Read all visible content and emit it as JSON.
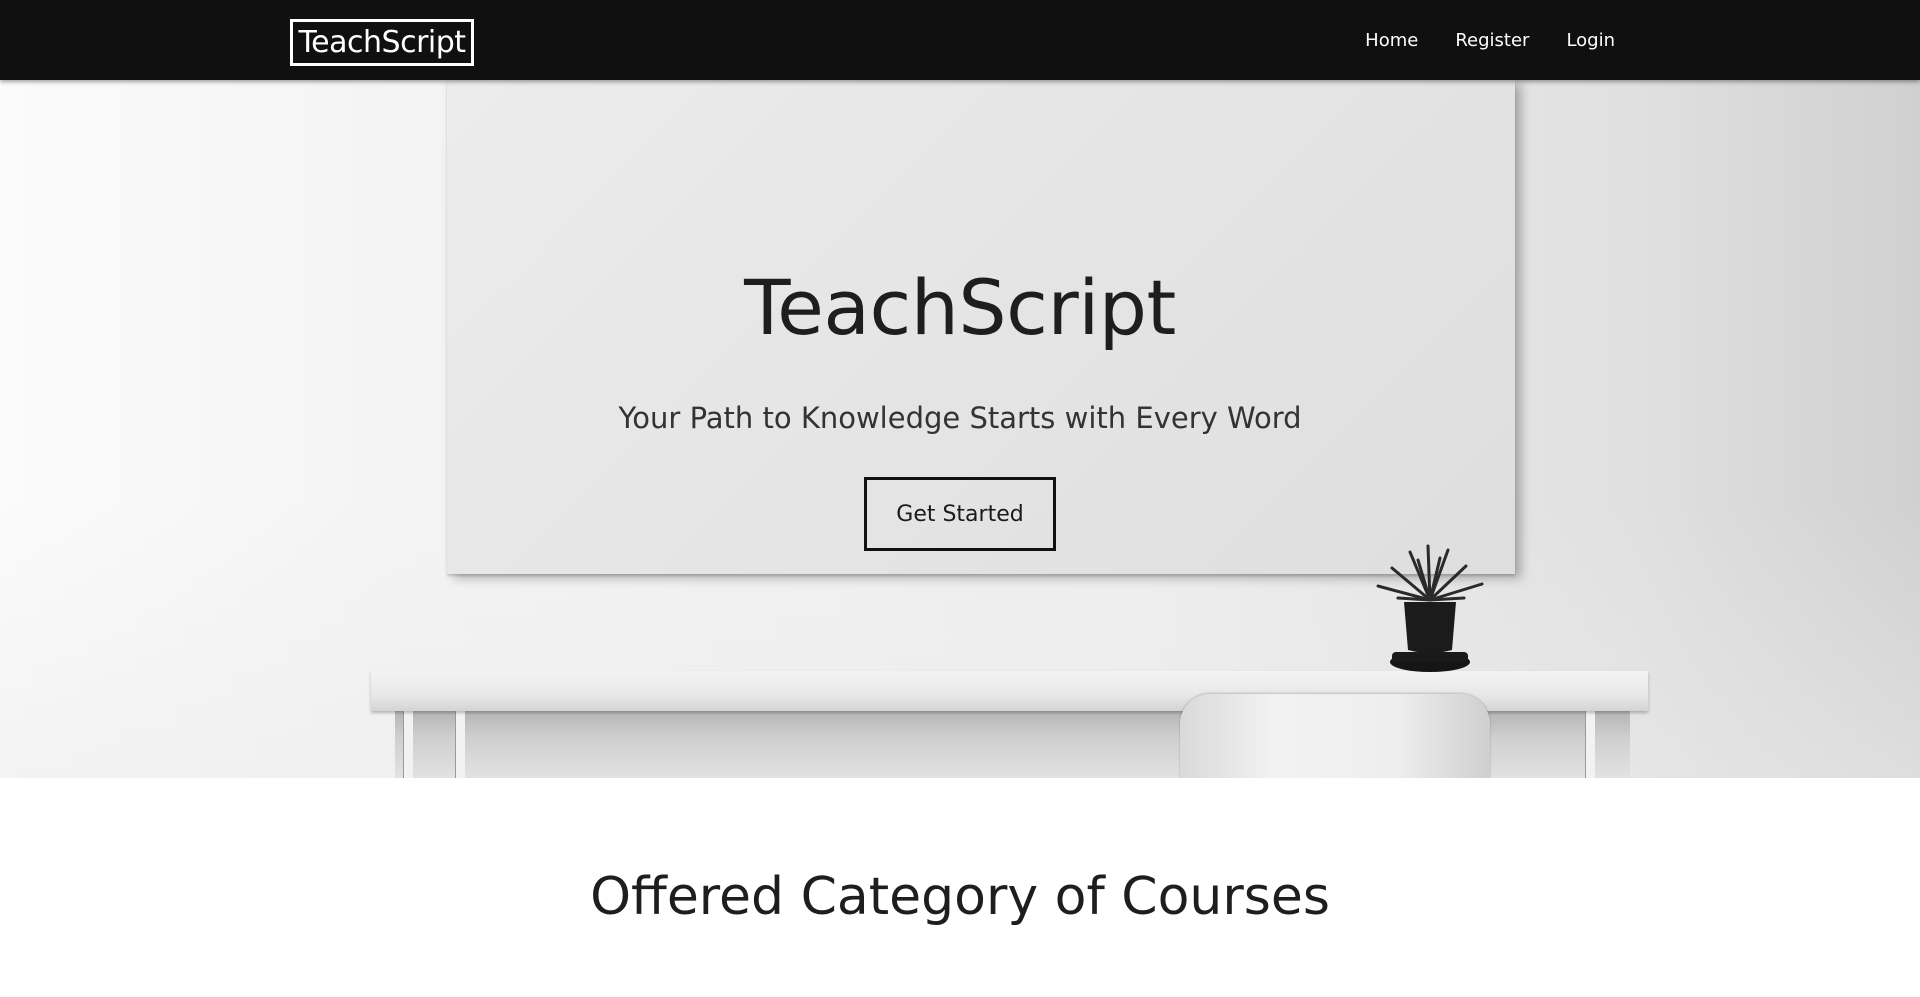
{
  "navbar": {
    "brand": "TeachScript",
    "links": [
      {
        "label": "Home"
      },
      {
        "label": "Register"
      },
      {
        "label": "Login"
      }
    ],
    "background": "#111011"
  },
  "hero": {
    "title": "TeachScript",
    "subtitle": "Your Path to Knowledge Starts with Every Word",
    "cta_label": "Get Started"
  },
  "courses_section": {
    "title": "Offered Category of Courses"
  }
}
